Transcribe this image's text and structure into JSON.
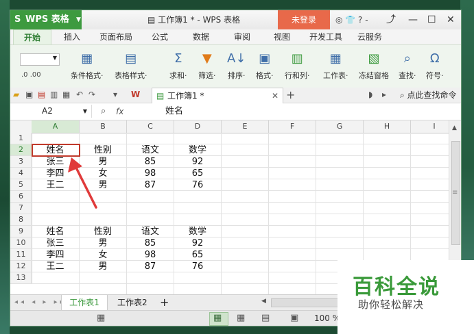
{
  "app": {
    "logo": "S",
    "name": "WPS 表格",
    "doc_title": "工作簿1 * - WPS 表格",
    "login_label": "未登录",
    "title_icons": "◎ 👕 ? -",
    "minimize": "—",
    "maximize": "☐",
    "close": "✕"
  },
  "tabs": [
    "开始",
    "插入",
    "页面布局",
    "公式",
    "数据",
    "审阅",
    "视图",
    "开发工具",
    "云服务"
  ],
  "ribbon": {
    "left_combo_value": "",
    "left_small": ".0  .00",
    "buttons": [
      {
        "icon": "▦",
        "label": "条件格式·"
      },
      {
        "icon": "▤",
        "label": "表格样式·"
      },
      {
        "icon": "Σ",
        "label": "求和·"
      },
      {
        "icon": "▼",
        "label": "筛选·"
      },
      {
        "icon": "A↓",
        "label": "排序·"
      },
      {
        "icon": "▣",
        "label": "格式·"
      },
      {
        "icon": "▥",
        "label": "行和列·"
      },
      {
        "icon": "▦",
        "label": "工作表·"
      },
      {
        "icon": "▧",
        "label": "冻结窗格"
      },
      {
        "icon": "⌕",
        "label": "查找·"
      },
      {
        "icon": "Ω",
        "label": "符号·"
      }
    ]
  },
  "quick_access": {
    "doc_tab": "工作簿1 *",
    "find_label": "点此查找命令"
  },
  "formula_bar": {
    "cell_ref": "A2",
    "fx": "fx",
    "value": "姓名"
  },
  "columns": [
    "A",
    "B",
    "C",
    "D",
    "E",
    "F",
    "G",
    "H",
    "I"
  ],
  "rows": [
    "1",
    "2",
    "3",
    "4",
    "5",
    "6",
    "7",
    "8",
    "9",
    "10",
    "11",
    "12",
    "13"
  ],
  "cells": [
    {
      "row": 2,
      "col": 0,
      "text": "姓名"
    },
    {
      "row": 2,
      "col": 1,
      "text": "性别"
    },
    {
      "row": 2,
      "col": 2,
      "text": "语文"
    },
    {
      "row": 2,
      "col": 3,
      "text": "数学"
    },
    {
      "row": 3,
      "col": 0,
      "text": "张三"
    },
    {
      "row": 3,
      "col": 1,
      "text": "男"
    },
    {
      "row": 3,
      "col": 2,
      "text": "85"
    },
    {
      "row": 3,
      "col": 3,
      "text": "92"
    },
    {
      "row": 4,
      "col": 0,
      "text": "李四"
    },
    {
      "row": 4,
      "col": 1,
      "text": "女"
    },
    {
      "row": 4,
      "col": 2,
      "text": "98"
    },
    {
      "row": 4,
      "col": 3,
      "text": "65"
    },
    {
      "row": 5,
      "col": 0,
      "text": "王二"
    },
    {
      "row": 5,
      "col": 1,
      "text": "男"
    },
    {
      "row": 5,
      "col": 2,
      "text": "87"
    },
    {
      "row": 5,
      "col": 3,
      "text": "76"
    },
    {
      "row": 9,
      "col": 0,
      "text": "姓名"
    },
    {
      "row": 9,
      "col": 1,
      "text": "性别"
    },
    {
      "row": 9,
      "col": 2,
      "text": "语文"
    },
    {
      "row": 9,
      "col": 3,
      "text": "数学"
    },
    {
      "row": 10,
      "col": 0,
      "text": "张三"
    },
    {
      "row": 10,
      "col": 1,
      "text": "男"
    },
    {
      "row": 10,
      "col": 2,
      "text": "85"
    },
    {
      "row": 10,
      "col": 3,
      "text": "92"
    },
    {
      "row": 11,
      "col": 0,
      "text": "李四"
    },
    {
      "row": 11,
      "col": 1,
      "text": "女"
    },
    {
      "row": 11,
      "col": 2,
      "text": "98"
    },
    {
      "row": 11,
      "col": 3,
      "text": "65"
    },
    {
      "row": 12,
      "col": 0,
      "text": "王二"
    },
    {
      "row": 12,
      "col": 1,
      "text": "男"
    },
    {
      "row": 12,
      "col": 2,
      "text": "87"
    },
    {
      "row": 12,
      "col": 3,
      "text": "76"
    }
  ],
  "sheets": {
    "nav": "◂◂ ◂ ▸ ▸▸",
    "tabs": [
      "工作表1",
      "工作表2"
    ],
    "add": "+"
  },
  "status": {
    "zoom": "100 %",
    "zoom_minus": "-",
    "zoom_plus": "+"
  },
  "watermark": {
    "title": "百科全说",
    "subtitle": "助你轻松解决"
  },
  "colors": {
    "brand_green": "#3d9a3f",
    "login_orange": "#e8694a",
    "selection_red": "#c0392b",
    "arrow_red": "#e03a3a"
  }
}
